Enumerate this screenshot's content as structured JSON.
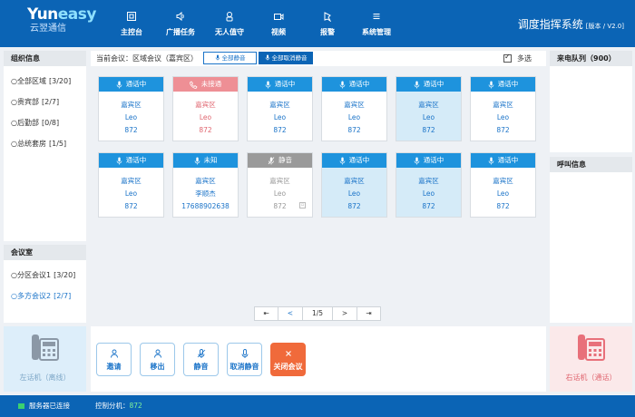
{
  "brand": {
    "en_main": "Yun",
    "en_sub": "easy",
    "cn": "云翌通信"
  },
  "nav": [
    {
      "label": "主控台",
      "icon": "dashboard-icon"
    },
    {
      "label": "广播任务",
      "icon": "broadcast-icon"
    },
    {
      "label": "无人值守",
      "icon": "unattended-icon"
    },
    {
      "label": "视频",
      "icon": "video-icon"
    },
    {
      "label": "报警",
      "icon": "alarm-icon"
    },
    {
      "label": "系统管理",
      "icon": "system-menu-icon"
    }
  ],
  "system_title": "调度指挥系统",
  "version": "[版本 / V2.0]",
  "org": {
    "title": "组织信息",
    "items": [
      {
        "label": "○全部区域",
        "count": "[3/20]"
      },
      {
        "label": "○贵宾部",
        "count": "[2/7]"
      },
      {
        "label": "○后勤部",
        "count": "[0/8]"
      },
      {
        "label": "○总统套房",
        "count": "[1/5]"
      }
    ]
  },
  "meeting_room": {
    "title": "会议室",
    "items": [
      {
        "label": "○分区会议1",
        "count": "[3/20]"
      },
      {
        "label": "○多方会议2",
        "count": "[2/7]"
      }
    ]
  },
  "conference": {
    "current_label": "当前会议：区域会议（嘉宾区）",
    "mute_all": "全部静音",
    "unmute_all": "全部取消静音",
    "multi_select": "多选"
  },
  "cards": [
    {
      "status": "通话中",
      "area": "嘉宾区",
      "name": "Leo",
      "number": "872",
      "state": "talk"
    },
    {
      "status": "未接通",
      "area": "嘉宾区",
      "name": "Leo",
      "number": "872",
      "state": "ring"
    },
    {
      "status": "通话中",
      "area": "嘉宾区",
      "name": "Leo",
      "number": "872",
      "state": "talk"
    },
    {
      "status": "通话中",
      "area": "嘉宾区",
      "name": "Leo",
      "number": "872",
      "state": "talk"
    },
    {
      "status": "通话中",
      "area": "嘉宾区",
      "name": "Leo",
      "number": "872",
      "state": "sel"
    },
    {
      "status": "通话中",
      "area": "嘉宾区",
      "name": "Leo",
      "number": "872",
      "state": "talk"
    },
    {
      "status": "通话中",
      "area": "嘉宾区",
      "name": "Leo",
      "number": "872",
      "state": "talk"
    },
    {
      "status": "未知",
      "area": "嘉宾区",
      "name": "李顺杰",
      "number": "17688902638",
      "state": "talk"
    },
    {
      "status": "静音",
      "area": "嘉宾区",
      "name": "Leo",
      "number": "872",
      "state": "mute"
    },
    {
      "status": "通话中",
      "area": "嘉宾区",
      "name": "Leo",
      "number": "872",
      "state": "sel"
    },
    {
      "status": "通话中",
      "area": "嘉宾区",
      "name": "Leo",
      "number": "872",
      "state": "sel"
    },
    {
      "status": "通话中",
      "area": "嘉宾区",
      "name": "Leo",
      "number": "872",
      "state": "talk"
    }
  ],
  "pager": {
    "first": "⇤",
    "prev": "<",
    "page": "1/5",
    "next": ">",
    "last": "⇥"
  },
  "incoming_queue": "来电队列（900）",
  "call_info": "呼叫信息",
  "left_phone": "左话机（离线）",
  "right_phone": "右话机（通话）",
  "actions": [
    {
      "label": "邀请",
      "icon": "invite-icon"
    },
    {
      "label": "移出",
      "icon": "remove-icon"
    },
    {
      "label": "静音",
      "icon": "mute-icon"
    },
    {
      "label": "取消静音",
      "icon": "unmute-icon"
    },
    {
      "label": "关闭会议",
      "icon": "close-icon"
    }
  ],
  "footer": {
    "status": "服务器已连接",
    "ext_label": "控制分机：",
    "ext_number": "872"
  },
  "colors": {
    "primary": "#0b64b5",
    "accent": "#1e93dd",
    "ring": "#ee8f95",
    "danger": "#f06a3b",
    "online": "#3bd16f"
  }
}
